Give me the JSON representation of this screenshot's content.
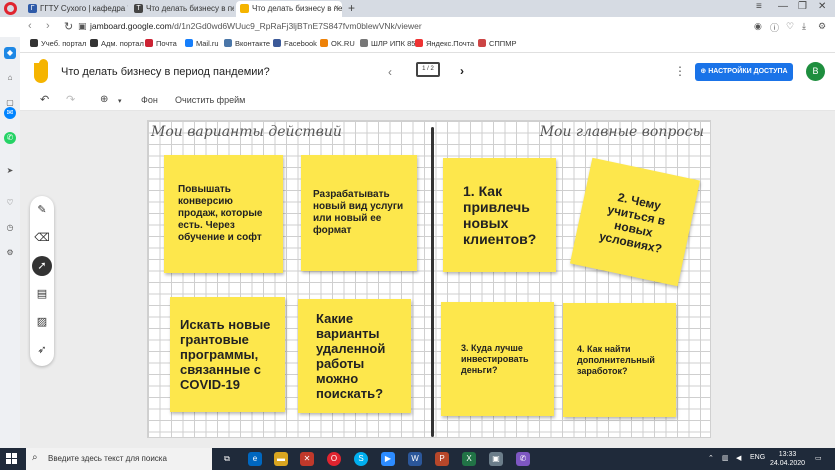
{
  "browser": {
    "tabs": [
      {
        "label": "ГГТУ Сухого | кафедра \"Э...",
        "active": false
      },
      {
        "label": "Что делать бизнесу в пер...",
        "active": false
      },
      {
        "label": "Что делать бизнесу в пер...",
        "active": true
      }
    ],
    "url_domain": "jamboard.google.com",
    "url_path": "/d/1n2Gd0wd6WUuc9_RpRaFj3ljBTnE7S847fvm0blewVNk/viewer",
    "bookmarks": [
      "Учеб. портал",
      "Адм. портал",
      "Почта",
      "Mail.ru",
      "Вконтакте",
      "Facebook",
      "OK.RU",
      "ШЛР ИПК 85",
      "Яндекс.Почта",
      "СППМР"
    ]
  },
  "jamboard": {
    "title": "Что делать бизнесу в период пандемии?",
    "frame_indicator": "1 / 2",
    "access_button": "НАСТРОЙКИ ДОСТУПА",
    "avatar_letter": "В",
    "toolbar": {
      "background": "Фон",
      "clear": "Очистить фрейм"
    }
  },
  "board": {
    "left_heading": "Мои варианты действий",
    "right_heading": "Мои главные вопросы",
    "notes": [
      {
        "text": "Повышать конверсию продаж, которые есть. Через обучение и софт"
      },
      {
        "text": "Разрабатывать новый вид услуги или новый ее формат"
      },
      {
        "text": "1. Как привлечь новых клиентов?"
      },
      {
        "text": "2. Чему учиться в новых условиях?"
      },
      {
        "text": "Искать новые грантовые программы, связанные с COVID-19"
      },
      {
        "text": "Какие варианты удаленной работы можно поискать?"
      },
      {
        "text": "3. Куда лучше инвестировать деньги?"
      },
      {
        "text": "4. Как найти дополнительный заработок?"
      }
    ]
  },
  "taskbar": {
    "search_placeholder": "Введите здесь текст для поиска",
    "language": "ENG",
    "time": "13:33",
    "date": "24.04.2020"
  },
  "colors": {
    "note_yellow": "#fde74c",
    "accent_blue": "#1a73e8",
    "opera_red": "#e0242f"
  }
}
